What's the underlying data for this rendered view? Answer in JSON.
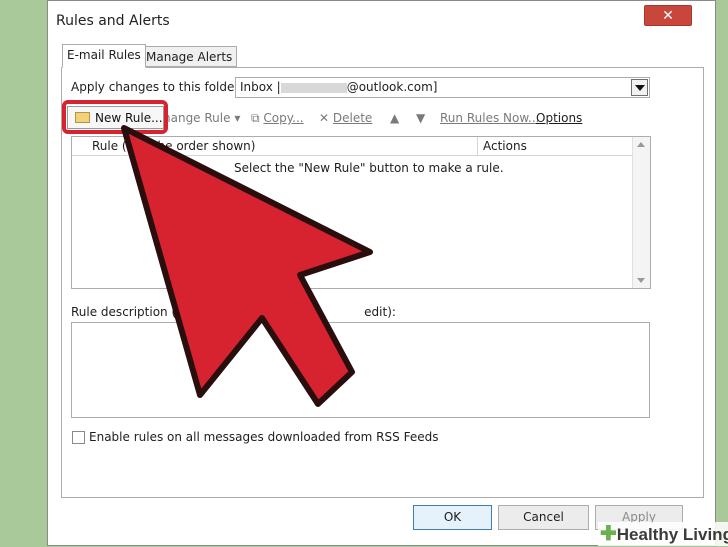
{
  "window": {
    "title": "Rules and Alerts",
    "close_glyph": "✕"
  },
  "tabs": [
    {
      "label": "E-mail Rules",
      "active": true
    },
    {
      "label": "Manage Alerts",
      "active": false
    }
  ],
  "folder": {
    "label": "Apply changes to this folder:",
    "value_prefix": "Inbox |",
    "value_suffix": "@outlook.com]"
  },
  "toolbar": {
    "new_rule": "New Rule...",
    "change_rule": "hange Rule",
    "copy": "Copy...",
    "delete": "Delete",
    "run_rules_now": "Run Rules Now...",
    "options": "Options"
  },
  "rules_list": {
    "col_rule_visible": "Rule (",
    "col_rule_tail": "d in the order shown)",
    "col_actions": "Actions",
    "empty_message": "Select the \"New Rule\" button to make a rule."
  },
  "rule_description": {
    "label_start": "Rule description (",
    "label_end": "edit):"
  },
  "rss": {
    "label": "Enable rules on all messages downloaded from RSS Feeds",
    "checked": false
  },
  "buttons": {
    "ok": "OK",
    "cancel": "Cancel",
    "apply": "Apply"
  },
  "overlay": {
    "arrow_color": "#d7222f",
    "highlight_color": "#d7222f"
  },
  "watermark": {
    "text": "Healthy Living"
  }
}
